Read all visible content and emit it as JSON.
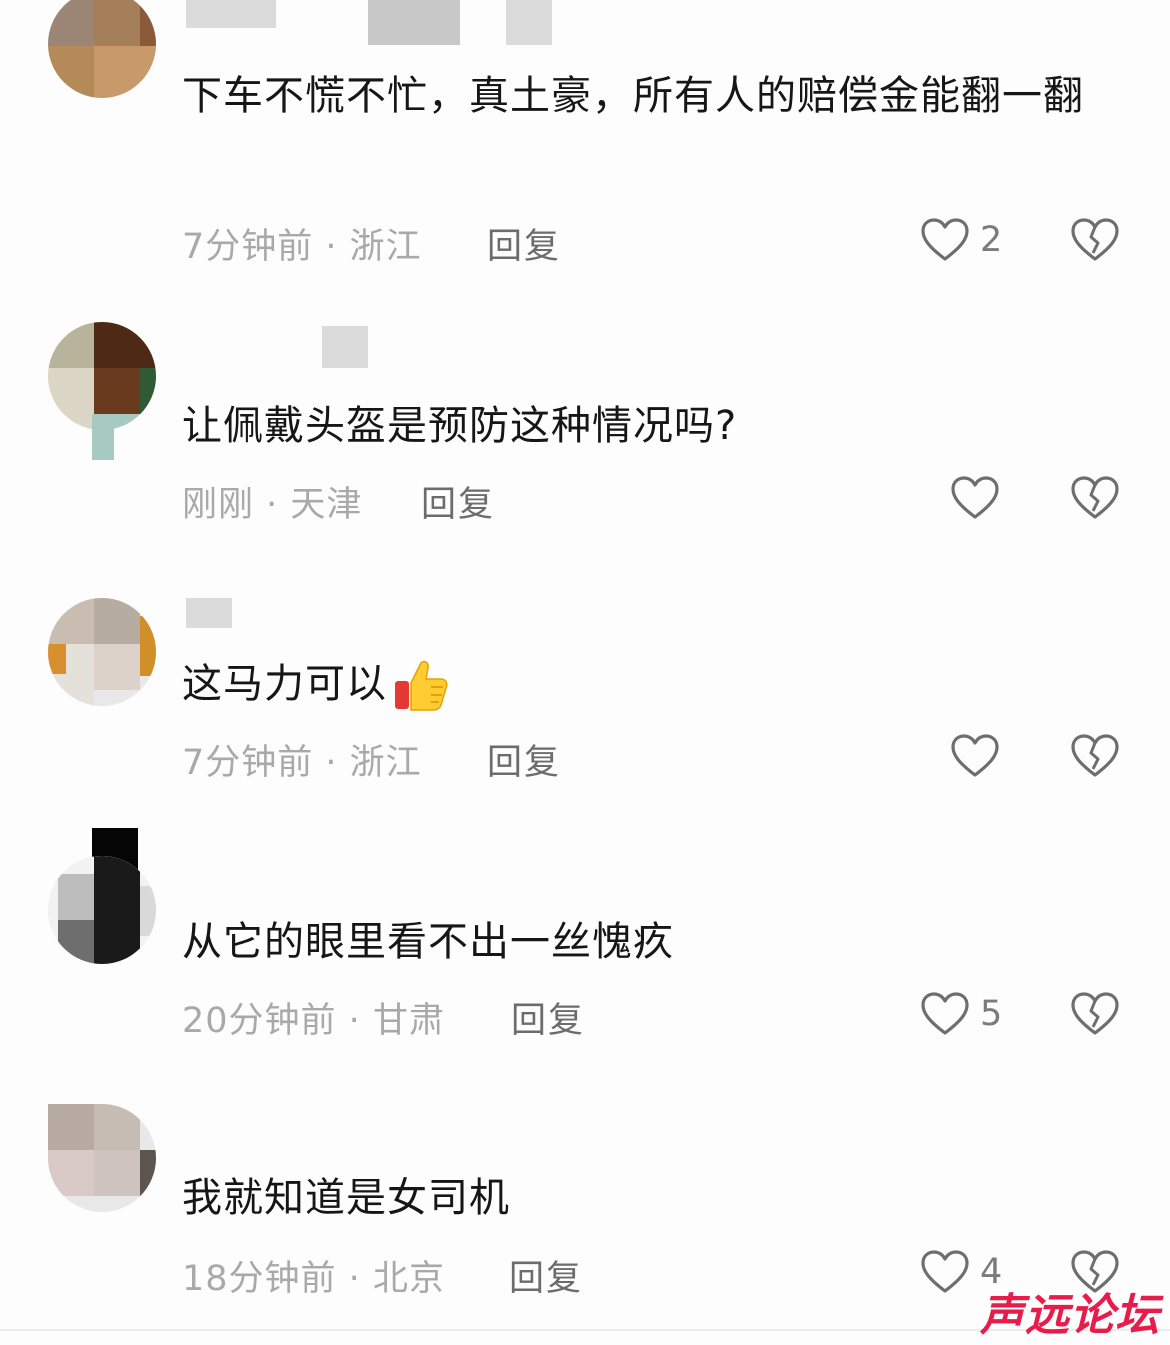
{
  "comments": [
    {
      "text": "下车不慌不忙，真土豪，所有人的赔偿金能翻一翻",
      "time": "7分钟前",
      "location": "浙江",
      "reply_label": "回复",
      "like_count": "2"
    },
    {
      "text": "让佩戴头盔是预防这种情况吗?",
      "time": "刚刚",
      "location": "天津",
      "reply_label": "回复",
      "like_count": ""
    },
    {
      "text": "这马力可以",
      "time": "7分钟前",
      "location": "浙江",
      "reply_label": "回复",
      "like_count": ""
    },
    {
      "text": "从它的眼里看不出一丝愧疚",
      "time": "20分钟前",
      "location": "甘肃",
      "reply_label": "回复",
      "like_count": "5"
    },
    {
      "text": "我就知道是女司机",
      "time": "18分钟前",
      "location": "北京",
      "reply_label": "回复",
      "like_count": "4"
    }
  ],
  "separator": " · ",
  "icons": {
    "like": "heart-outline-icon",
    "dislike": "broken-heart-icon",
    "emoji": "thumbs-up-emoji-icon"
  },
  "watermark": "声远论坛",
  "colors": {
    "text": "#161616",
    "meta": "#a9a9a9",
    "icon": "#6e6e6e",
    "watermark": "#e81c4a"
  }
}
